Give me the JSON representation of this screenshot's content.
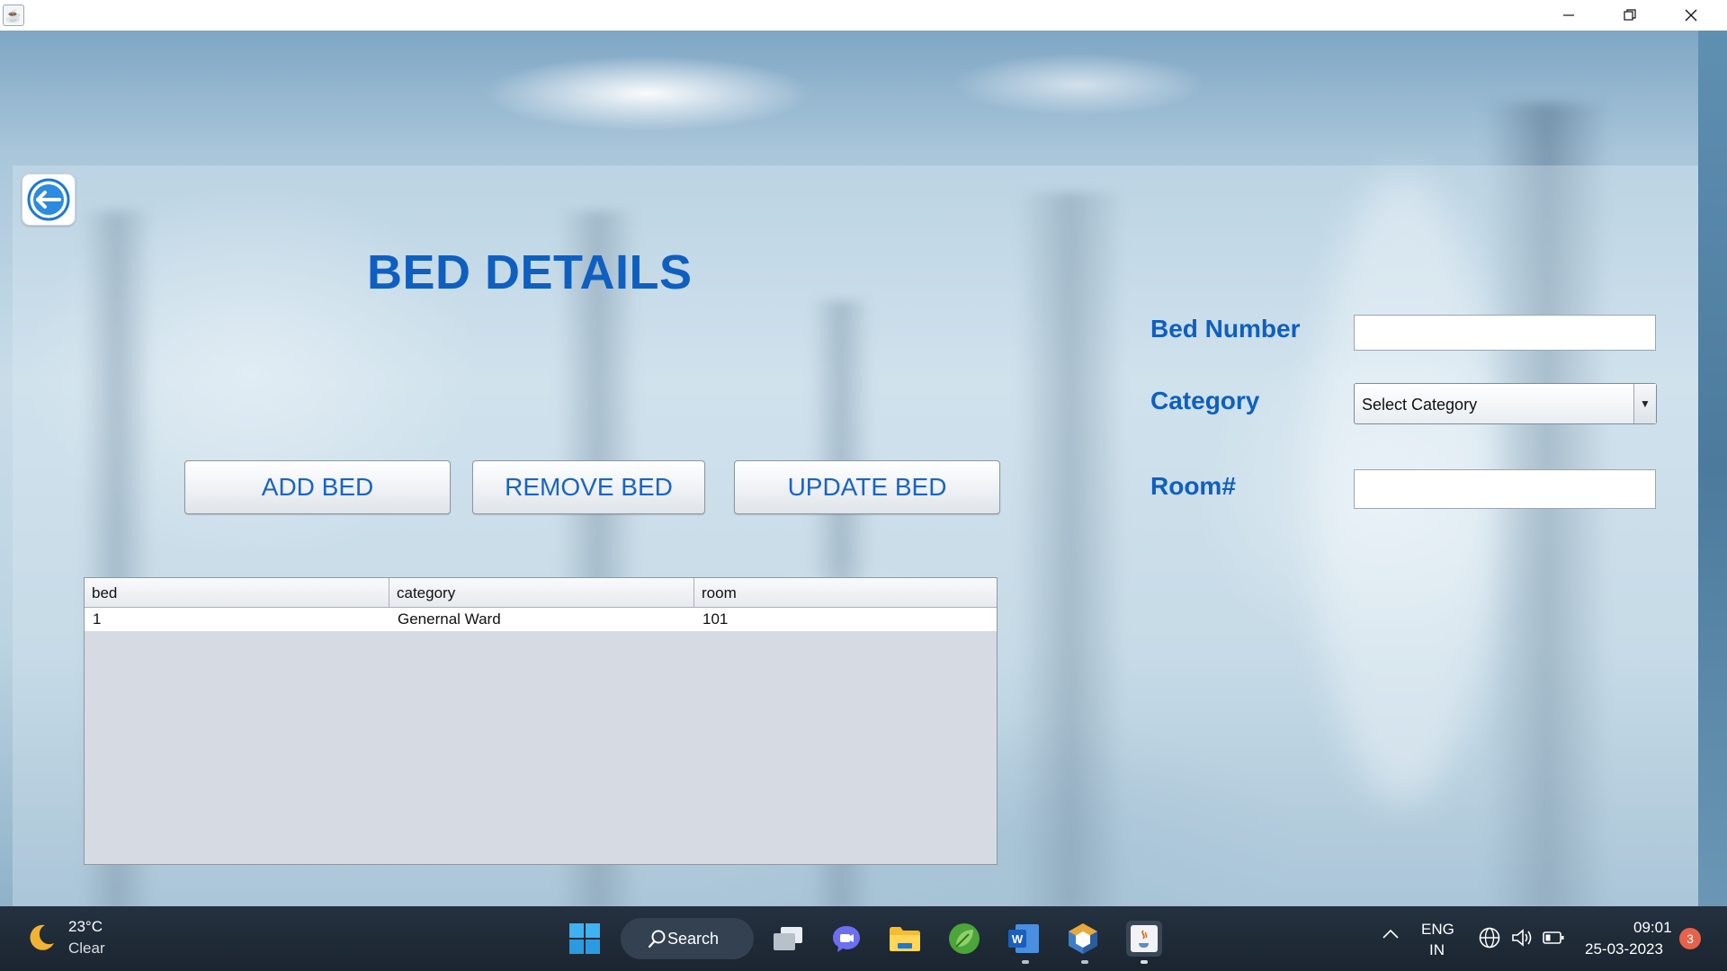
{
  "window": {
    "minimize_icon": "minimize-icon",
    "maximize_icon": "restore-icon",
    "close_icon": "close-icon"
  },
  "page": {
    "title": "BED DETAILS",
    "back_icon": "back-arrow-icon"
  },
  "actions": {
    "add_label": "ADD BED",
    "remove_label": "REMOVE BED",
    "update_label": "UPDATE BED"
  },
  "form": {
    "bed_number_label": "Bed Number",
    "bed_number_value": "",
    "category_label": "Category",
    "category_selected": "Select Category",
    "room_label": "Room#",
    "room_value": ""
  },
  "table": {
    "columns": [
      "bed",
      "category",
      "room"
    ],
    "rows": [
      [
        "1",
        "Genernal Ward",
        "101"
      ]
    ]
  },
  "taskbar": {
    "weather_temp": "23°C",
    "weather_desc": "Clear",
    "search_label": "Search",
    "lang_line1": "ENG",
    "lang_line2": "IN",
    "time": "09:01",
    "date": "25-03-2023",
    "notification_count": "3",
    "accent": "#0f5fc0"
  }
}
